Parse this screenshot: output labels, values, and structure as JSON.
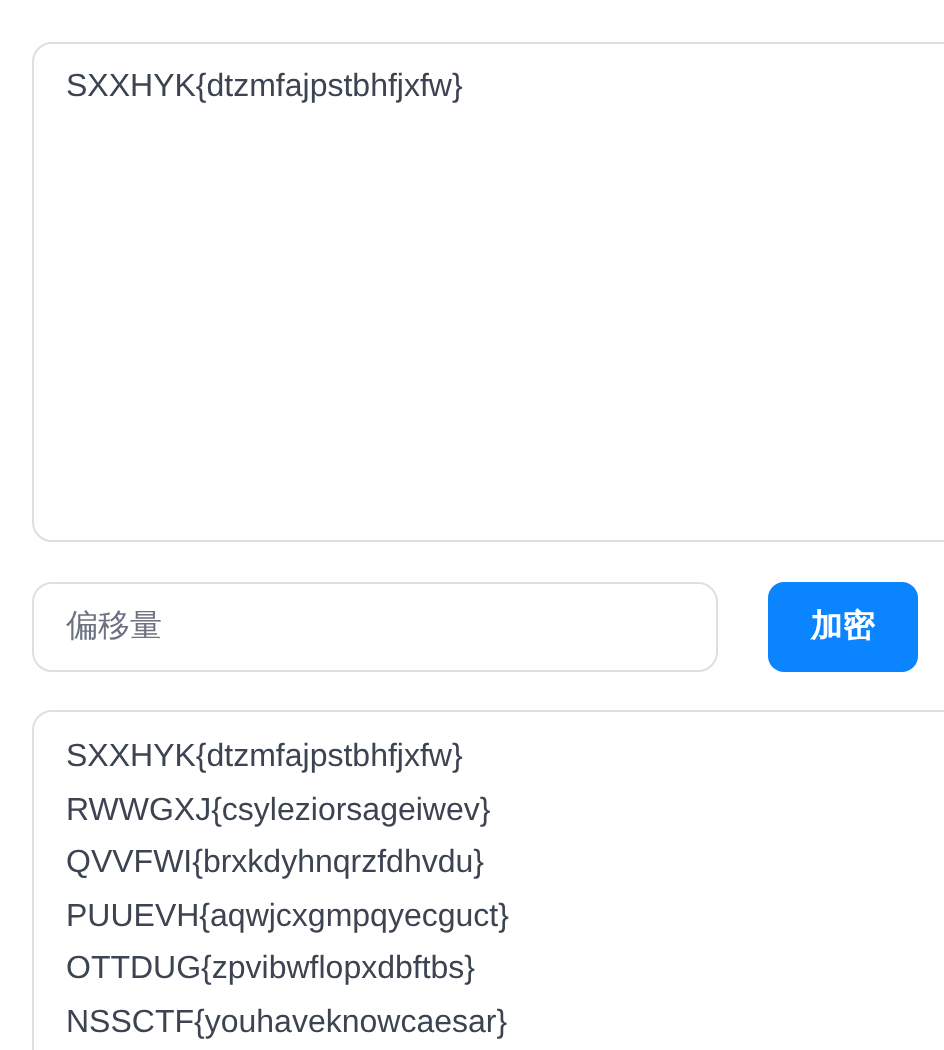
{
  "input": {
    "value": "SXXHYK{dtzmfajpstbhfjxfw}"
  },
  "shift": {
    "placeholder": "偏移量"
  },
  "encrypt_button": {
    "label": "加密"
  },
  "output": {
    "lines": [
      "SXXHYK{dtzmfajpstbhfjxfw}",
      "RWWGXJ{csyleziorsageiwev}",
      "QVVFWI{brxkdyhnqrzfdhvdu}",
      "PUUEVH{aqwjcxgmpqyecguct}",
      "OTTDUG{zpvibwflopxdbftbs}",
      "NSSCTF{youhaveknowcaesar}"
    ]
  }
}
